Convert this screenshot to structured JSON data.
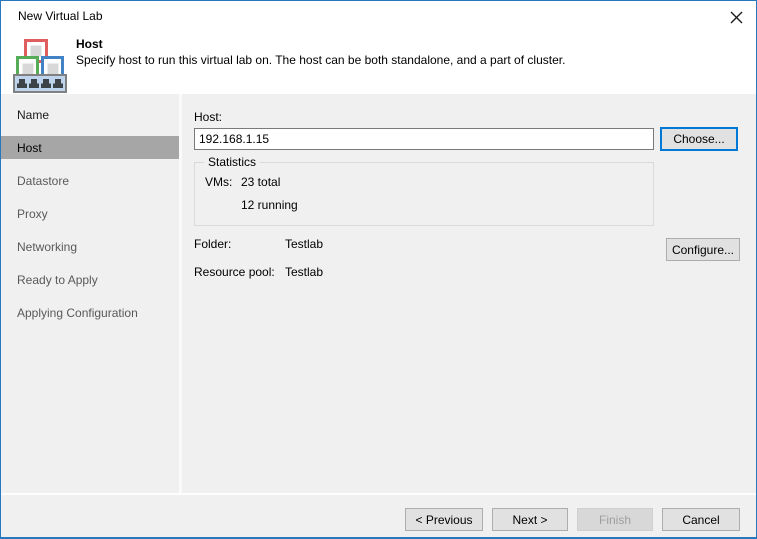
{
  "window": {
    "title": "New Virtual Lab",
    "close_icon": "close-x"
  },
  "header": {
    "step_title": "Host",
    "description": "Specify host to run this virtual lab on. The host can be both standalone, and a part of cluster.",
    "icon": "virtual-lab-stacked-squares-icon"
  },
  "sidebar": {
    "items": [
      {
        "label": "Name",
        "state": "done"
      },
      {
        "label": "Host",
        "state": "current"
      },
      {
        "label": "Datastore",
        "state": "upcoming"
      },
      {
        "label": "Proxy",
        "state": "upcoming"
      },
      {
        "label": "Networking",
        "state": "upcoming"
      },
      {
        "label": "Ready to Apply",
        "state": "upcoming"
      },
      {
        "label": "Applying Configuration",
        "state": "upcoming"
      }
    ]
  },
  "main": {
    "host_label": "Host:",
    "host_value": "192.168.1.15",
    "choose_button": "Choose...",
    "statistics": {
      "title": "Statistics",
      "vms_label": "VMs:",
      "total": "23 total",
      "running": "12 running"
    },
    "folder_label": "Folder:",
    "folder_value": "Testlab",
    "resource_pool_label": "Resource pool:",
    "resource_pool_value": "Testlab",
    "configure_button": "Configure..."
  },
  "footer": {
    "previous": "< Previous",
    "next": "Next >",
    "finish": "Finish",
    "cancel": "Cancel"
  },
  "colors": {
    "window_border": "#2878be",
    "selected_item_bg": "#a6a6a6",
    "focus_button_border": "#0078d7",
    "content_bg": "#f0f0f0",
    "header_bg": "#ffffff"
  }
}
